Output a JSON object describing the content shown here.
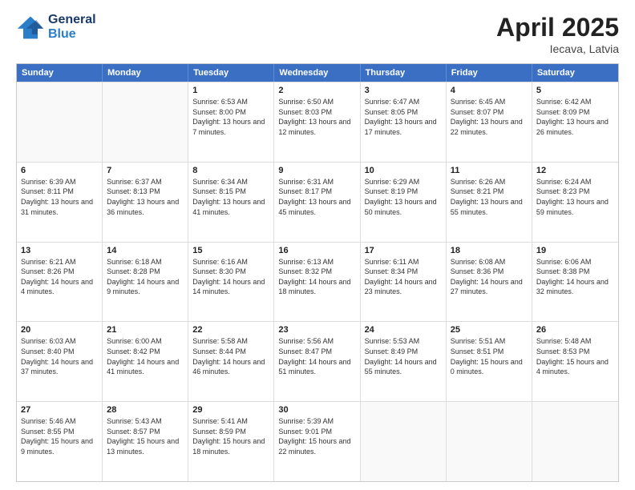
{
  "logo": {
    "line1": "General",
    "line2": "Blue"
  },
  "title": "April 2025",
  "location": "Iecava, Latvia",
  "days_of_week": [
    "Sunday",
    "Monday",
    "Tuesday",
    "Wednesday",
    "Thursday",
    "Friday",
    "Saturday"
  ],
  "weeks": [
    [
      {
        "day": "",
        "sunrise": "",
        "sunset": "",
        "daylight": "",
        "empty": true
      },
      {
        "day": "",
        "sunrise": "",
        "sunset": "",
        "daylight": "",
        "empty": true
      },
      {
        "day": "1",
        "sunrise": "Sunrise: 6:53 AM",
        "sunset": "Sunset: 8:00 PM",
        "daylight": "Daylight: 13 hours and 7 minutes.",
        "empty": false
      },
      {
        "day": "2",
        "sunrise": "Sunrise: 6:50 AM",
        "sunset": "Sunset: 8:03 PM",
        "daylight": "Daylight: 13 hours and 12 minutes.",
        "empty": false
      },
      {
        "day": "3",
        "sunrise": "Sunrise: 6:47 AM",
        "sunset": "Sunset: 8:05 PM",
        "daylight": "Daylight: 13 hours and 17 minutes.",
        "empty": false
      },
      {
        "day": "4",
        "sunrise": "Sunrise: 6:45 AM",
        "sunset": "Sunset: 8:07 PM",
        "daylight": "Daylight: 13 hours and 22 minutes.",
        "empty": false
      },
      {
        "day": "5",
        "sunrise": "Sunrise: 6:42 AM",
        "sunset": "Sunset: 8:09 PM",
        "daylight": "Daylight: 13 hours and 26 minutes.",
        "empty": false
      }
    ],
    [
      {
        "day": "6",
        "sunrise": "Sunrise: 6:39 AM",
        "sunset": "Sunset: 8:11 PM",
        "daylight": "Daylight: 13 hours and 31 minutes.",
        "empty": false
      },
      {
        "day": "7",
        "sunrise": "Sunrise: 6:37 AM",
        "sunset": "Sunset: 8:13 PM",
        "daylight": "Daylight: 13 hours and 36 minutes.",
        "empty": false
      },
      {
        "day": "8",
        "sunrise": "Sunrise: 6:34 AM",
        "sunset": "Sunset: 8:15 PM",
        "daylight": "Daylight: 13 hours and 41 minutes.",
        "empty": false
      },
      {
        "day": "9",
        "sunrise": "Sunrise: 6:31 AM",
        "sunset": "Sunset: 8:17 PM",
        "daylight": "Daylight: 13 hours and 45 minutes.",
        "empty": false
      },
      {
        "day": "10",
        "sunrise": "Sunrise: 6:29 AM",
        "sunset": "Sunset: 8:19 PM",
        "daylight": "Daylight: 13 hours and 50 minutes.",
        "empty": false
      },
      {
        "day": "11",
        "sunrise": "Sunrise: 6:26 AM",
        "sunset": "Sunset: 8:21 PM",
        "daylight": "Daylight: 13 hours and 55 minutes.",
        "empty": false
      },
      {
        "day": "12",
        "sunrise": "Sunrise: 6:24 AM",
        "sunset": "Sunset: 8:23 PM",
        "daylight": "Daylight: 13 hours and 59 minutes.",
        "empty": false
      }
    ],
    [
      {
        "day": "13",
        "sunrise": "Sunrise: 6:21 AM",
        "sunset": "Sunset: 8:26 PM",
        "daylight": "Daylight: 14 hours and 4 minutes.",
        "empty": false
      },
      {
        "day": "14",
        "sunrise": "Sunrise: 6:18 AM",
        "sunset": "Sunset: 8:28 PM",
        "daylight": "Daylight: 14 hours and 9 minutes.",
        "empty": false
      },
      {
        "day": "15",
        "sunrise": "Sunrise: 6:16 AM",
        "sunset": "Sunset: 8:30 PM",
        "daylight": "Daylight: 14 hours and 14 minutes.",
        "empty": false
      },
      {
        "day": "16",
        "sunrise": "Sunrise: 6:13 AM",
        "sunset": "Sunset: 8:32 PM",
        "daylight": "Daylight: 14 hours and 18 minutes.",
        "empty": false
      },
      {
        "day": "17",
        "sunrise": "Sunrise: 6:11 AM",
        "sunset": "Sunset: 8:34 PM",
        "daylight": "Daylight: 14 hours and 23 minutes.",
        "empty": false
      },
      {
        "day": "18",
        "sunrise": "Sunrise: 6:08 AM",
        "sunset": "Sunset: 8:36 PM",
        "daylight": "Daylight: 14 hours and 27 minutes.",
        "empty": false
      },
      {
        "day": "19",
        "sunrise": "Sunrise: 6:06 AM",
        "sunset": "Sunset: 8:38 PM",
        "daylight": "Daylight: 14 hours and 32 minutes.",
        "empty": false
      }
    ],
    [
      {
        "day": "20",
        "sunrise": "Sunrise: 6:03 AM",
        "sunset": "Sunset: 8:40 PM",
        "daylight": "Daylight: 14 hours and 37 minutes.",
        "empty": false
      },
      {
        "day": "21",
        "sunrise": "Sunrise: 6:00 AM",
        "sunset": "Sunset: 8:42 PM",
        "daylight": "Daylight: 14 hours and 41 minutes.",
        "empty": false
      },
      {
        "day": "22",
        "sunrise": "Sunrise: 5:58 AM",
        "sunset": "Sunset: 8:44 PM",
        "daylight": "Daylight: 14 hours and 46 minutes.",
        "empty": false
      },
      {
        "day": "23",
        "sunrise": "Sunrise: 5:56 AM",
        "sunset": "Sunset: 8:47 PM",
        "daylight": "Daylight: 14 hours and 51 minutes.",
        "empty": false
      },
      {
        "day": "24",
        "sunrise": "Sunrise: 5:53 AM",
        "sunset": "Sunset: 8:49 PM",
        "daylight": "Daylight: 14 hours and 55 minutes.",
        "empty": false
      },
      {
        "day": "25",
        "sunrise": "Sunrise: 5:51 AM",
        "sunset": "Sunset: 8:51 PM",
        "daylight": "Daylight: 15 hours and 0 minutes.",
        "empty": false
      },
      {
        "day": "26",
        "sunrise": "Sunrise: 5:48 AM",
        "sunset": "Sunset: 8:53 PM",
        "daylight": "Daylight: 15 hours and 4 minutes.",
        "empty": false
      }
    ],
    [
      {
        "day": "27",
        "sunrise": "Sunrise: 5:46 AM",
        "sunset": "Sunset: 8:55 PM",
        "daylight": "Daylight: 15 hours and 9 minutes.",
        "empty": false
      },
      {
        "day": "28",
        "sunrise": "Sunrise: 5:43 AM",
        "sunset": "Sunset: 8:57 PM",
        "daylight": "Daylight: 15 hours and 13 minutes.",
        "empty": false
      },
      {
        "day": "29",
        "sunrise": "Sunrise: 5:41 AM",
        "sunset": "Sunset: 8:59 PM",
        "daylight": "Daylight: 15 hours and 18 minutes.",
        "empty": false
      },
      {
        "day": "30",
        "sunrise": "Sunrise: 5:39 AM",
        "sunset": "Sunset: 9:01 PM",
        "daylight": "Daylight: 15 hours and 22 minutes.",
        "empty": false
      },
      {
        "day": "",
        "sunrise": "",
        "sunset": "",
        "daylight": "",
        "empty": true
      },
      {
        "day": "",
        "sunrise": "",
        "sunset": "",
        "daylight": "",
        "empty": true
      },
      {
        "day": "",
        "sunrise": "",
        "sunset": "",
        "daylight": "",
        "empty": true
      }
    ]
  ]
}
